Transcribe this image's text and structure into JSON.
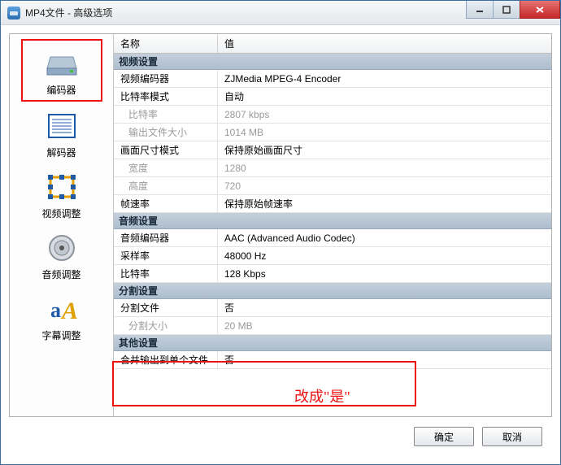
{
  "window": {
    "title": "MP4文件 - 高级选项"
  },
  "sidebar": {
    "items": [
      {
        "label": "编码器"
      },
      {
        "label": "解码器"
      },
      {
        "label": "视频调整"
      },
      {
        "label": "音频调整"
      },
      {
        "label": "字幕调整"
      }
    ]
  },
  "header": {
    "name": "名称",
    "value": "值"
  },
  "sections": {
    "video": {
      "title": "视频设置",
      "rows": [
        {
          "k": "视频编码器",
          "v": "ZJMedia MPEG-4 Encoder"
        },
        {
          "k": "比特率模式",
          "v": "自动"
        },
        {
          "k": "比特率",
          "v": "2807 kbps",
          "disabled": true
        },
        {
          "k": "输出文件大小",
          "v": "1014 MB",
          "disabled": true
        },
        {
          "k": "画面尺寸模式",
          "v": "保持原始画面尺寸"
        },
        {
          "k": "宽度",
          "v": "1280",
          "disabled": true
        },
        {
          "k": "高度",
          "v": "720",
          "disabled": true
        },
        {
          "k": "帧速率",
          "v": "保持原始帧速率"
        }
      ]
    },
    "audio": {
      "title": "音频设置",
      "rows": [
        {
          "k": "音频编码器",
          "v": "AAC (Advanced Audio Codec)"
        },
        {
          "k": "采样率",
          "v": "48000 Hz"
        },
        {
          "k": "比特率",
          "v": "128 Kbps"
        }
      ]
    },
    "split": {
      "title": "分割设置",
      "rows": [
        {
          "k": "分割文件",
          "v": "否"
        },
        {
          "k": "分割大小",
          "v": "20 MB",
          "disabled": true
        }
      ]
    },
    "other": {
      "title": "其他设置",
      "rows": [
        {
          "k": "合并输出到单个文件",
          "v": "否"
        }
      ]
    }
  },
  "annotation": {
    "text": "改成\"是\""
  },
  "buttons": {
    "ok": "确定",
    "cancel": "取消"
  }
}
